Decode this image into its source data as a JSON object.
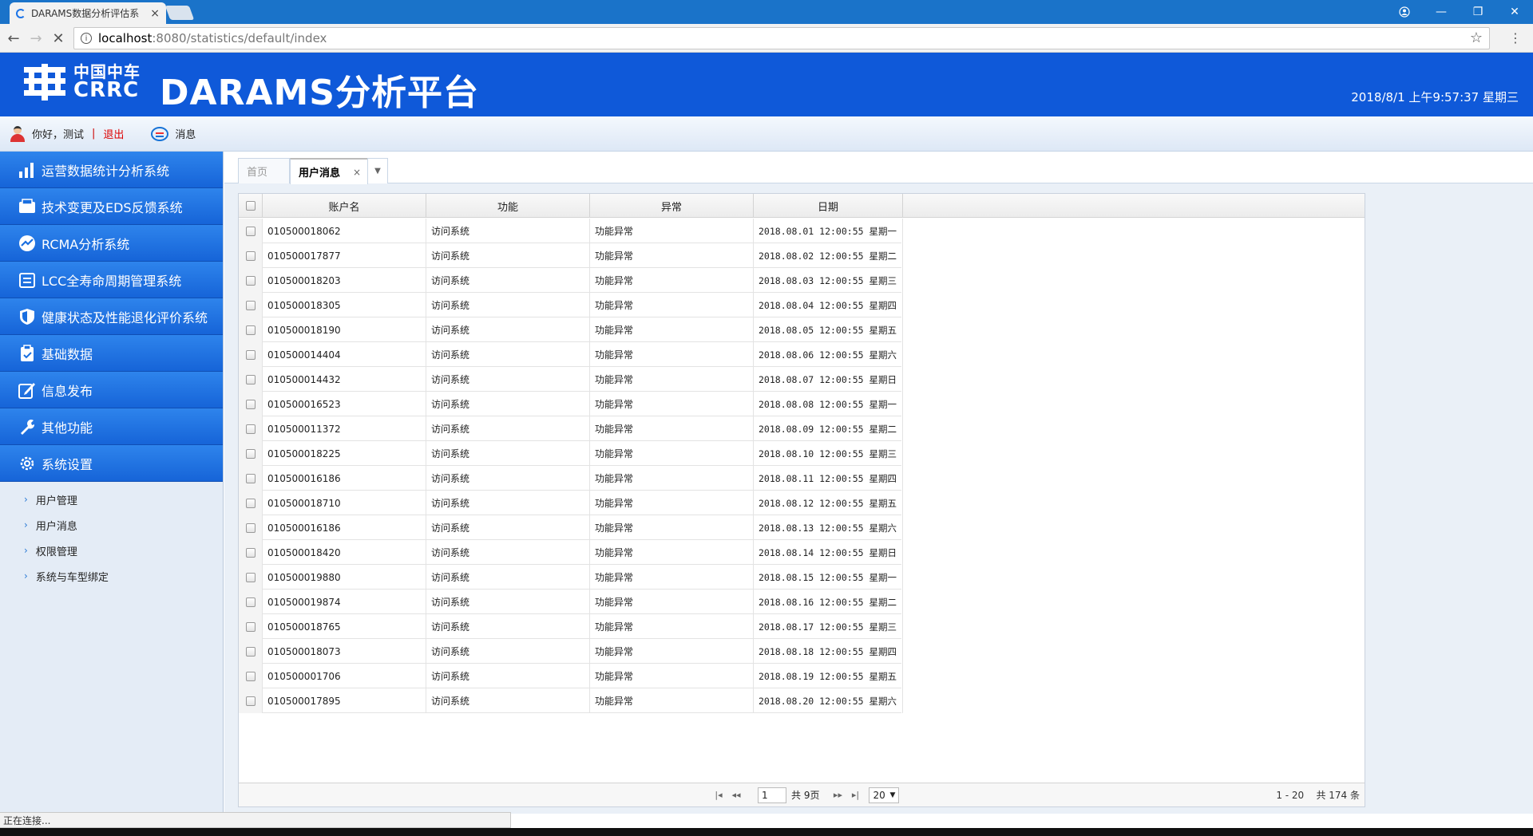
{
  "browser": {
    "tab_title": "DARAMS数据分析评估系",
    "tab_close": "×",
    "url_host": "localhost",
    "url_rest": ":8080/statistics/default/index",
    "win_minimize": "—",
    "win_restore": "❐",
    "win_close": "✕",
    "status": "正在连接..."
  },
  "header": {
    "logo_cn": "中国中车",
    "logo_en": "CRRC",
    "title": "DARAMS分析平台",
    "clock": "2018/8/1 上午9:57:37 星期三"
  },
  "greeting": {
    "hello": "你好，测试",
    "separator": "|",
    "logout": "退出",
    "messages": "消息"
  },
  "sidebar": {
    "items": [
      {
        "label": "运营数据统计分析系统",
        "icon": "bar-chart-icon"
      },
      {
        "label": "技术变更及EDS反馈系统",
        "icon": "inbox-icon"
      },
      {
        "label": "RCMA分析系统",
        "icon": "trend-icon"
      },
      {
        "label": "LCC全寿命周期管理系统",
        "icon": "calendar-icon"
      },
      {
        "label": "健康状态及性能退化评价系统",
        "icon": "shield-icon"
      },
      {
        "label": "基础数据",
        "icon": "clipboard-icon"
      },
      {
        "label": "信息发布",
        "icon": "edit-icon"
      },
      {
        "label": "其他功能",
        "icon": "wrench-icon"
      },
      {
        "label": "系统设置",
        "icon": "gear-icon"
      }
    ],
    "sub_items": [
      {
        "label": "用户管理"
      },
      {
        "label": "用户消息"
      },
      {
        "label": "权限管理"
      },
      {
        "label": "系统与车型绑定"
      }
    ]
  },
  "tabs": {
    "home": "首页",
    "active": "用户消息",
    "close": "×",
    "more": "▼"
  },
  "table": {
    "columns": [
      "账户名",
      "功能",
      "异常",
      "日期"
    ],
    "rows": [
      {
        "account": "010500018062",
        "func": "访问系统",
        "error": "功能异常",
        "date": "2018.08.01 12:00:55 星期一"
      },
      {
        "account": "010500017877",
        "func": "访问系统",
        "error": "功能异常",
        "date": "2018.08.02 12:00:55 星期二"
      },
      {
        "account": "010500018203",
        "func": "访问系统",
        "error": "功能异常",
        "date": "2018.08.03 12:00:55 星期三"
      },
      {
        "account": "010500018305",
        "func": "访问系统",
        "error": "功能异常",
        "date": "2018.08.04 12:00:55 星期四"
      },
      {
        "account": "010500018190",
        "func": "访问系统",
        "error": "功能异常",
        "date": "2018.08.05 12:00:55 星期五"
      },
      {
        "account": "010500014404",
        "func": "访问系统",
        "error": "功能异常",
        "date": "2018.08.06 12:00:55 星期六"
      },
      {
        "account": "010500014432",
        "func": "访问系统",
        "error": "功能异常",
        "date": "2018.08.07 12:00:55 星期日"
      },
      {
        "account": "010500016523",
        "func": "访问系统",
        "error": "功能异常",
        "date": "2018.08.08 12:00:55 星期一"
      },
      {
        "account": "010500011372",
        "func": "访问系统",
        "error": "功能异常",
        "date": "2018.08.09 12:00:55 星期二"
      },
      {
        "account": "010500018225",
        "func": "访问系统",
        "error": "功能异常",
        "date": "2018.08.10 12:00:55 星期三"
      },
      {
        "account": "010500016186",
        "func": "访问系统",
        "error": "功能异常",
        "date": "2018.08.11 12:00:55 星期四"
      },
      {
        "account": "010500018710",
        "func": "访问系统",
        "error": "功能异常",
        "date": "2018.08.12 12:00:55 星期五"
      },
      {
        "account": "010500016186",
        "func": "访问系统",
        "error": "功能异常",
        "date": "2018.08.13 12:00:55 星期六"
      },
      {
        "account": "010500018420",
        "func": "访问系统",
        "error": "功能异常",
        "date": "2018.08.14 12:00:55 星期日"
      },
      {
        "account": "010500019880",
        "func": "访问系统",
        "error": "功能异常",
        "date": "2018.08.15 12:00:55 星期一"
      },
      {
        "account": "010500019874",
        "func": "访问系统",
        "error": "功能异常",
        "date": "2018.08.16 12:00:55 星期二"
      },
      {
        "account": "010500018765",
        "func": "访问系统",
        "error": "功能异常",
        "date": "2018.08.17 12:00:55 星期三"
      },
      {
        "account": "010500018073",
        "func": "访问系统",
        "error": "功能异常",
        "date": "2018.08.18 12:00:55 星期四"
      },
      {
        "account": "010500001706",
        "func": "访问系统",
        "error": "功能异常",
        "date": "2018.08.19 12:00:55 星期五"
      },
      {
        "account": "010500017895",
        "func": "访问系统",
        "error": "功能异常",
        "date": "2018.08.20 12:00:55 星期六"
      }
    ]
  },
  "pager": {
    "page": "1",
    "total_pages": "共 9页",
    "page_size": "20",
    "range": "1 - 20",
    "total": "共 174 条"
  },
  "colors": {
    "brand": "#0f59d9",
    "nav": "#1a6fe0",
    "logout": "#dd0000"
  }
}
